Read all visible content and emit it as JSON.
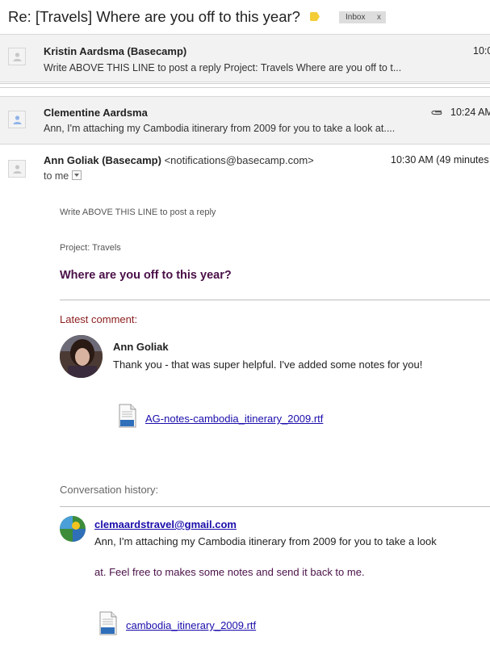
{
  "subject": {
    "title": "Re: [Travels] Where are you off to this year?",
    "label_name": "Inbox",
    "label_remove": "x",
    "tag_color": "#f4cc35"
  },
  "messages": [
    {
      "sender": "Kristin Aardsma (Basecamp)",
      "snippet": "Write ABOVE THIS LINE to post a reply Project: Travels Where are you off to t...",
      "time": "10:0"
    },
    {
      "sender": "Clementine Aardsma",
      "snippet": "Ann, I'm attaching my Cambodia itinerary from 2009 for you to take a look at....",
      "time": "10:24 AM (",
      "has_attachment": true
    }
  ],
  "open_message": {
    "sender": "Ann Goliak (Basecamp)",
    "email": "<notifications@basecamp.com>",
    "time": "10:30 AM (49 minutes",
    "to": "to me",
    "body": {
      "reply_line": "Write ABOVE THIS LINE to post a reply",
      "project": "Project: Travels",
      "headline": "Where are you off to this year?",
      "latest_label": "Latest comment:",
      "commenter": "Ann Goliak",
      "comment": "Thank you - that was super helpful. I've added some notes for you!",
      "attachment": "AG-notes-cambodia_itinerary_2009.rtf",
      "history_label": "Conversation history:",
      "history_email": "clemaardstravel@gmail.com",
      "history_line1": "Ann, I'm attaching my Cambodia itinerary from 2009 for you to take a look",
      "history_line2": "at. Feel free to makes some notes and send it back to me.",
      "history_attachment": "cambodia_itinerary_2009.rtf"
    }
  },
  "colors": {
    "headline": "#4a1048",
    "latest_label": "#8c1d1d",
    "link": "#1a0dab"
  }
}
